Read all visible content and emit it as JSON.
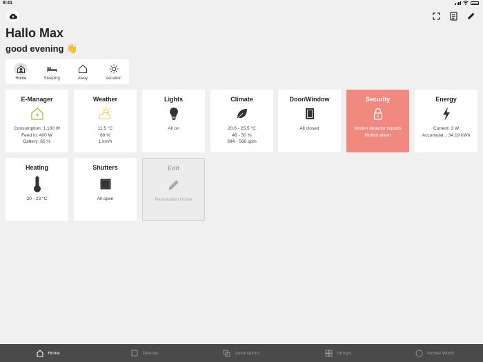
{
  "status_bar": {
    "time": "9:41"
  },
  "greeting": {
    "title": "Hallo Max",
    "subtitle": "good evening 👋"
  },
  "modes": [
    {
      "label": "Home",
      "icon": "home-person-icon",
      "active": true
    },
    {
      "label": "Sleeping",
      "icon": "bed-icon"
    },
    {
      "label": "Away",
      "icon": "house-outline-icon"
    },
    {
      "label": "Vacation",
      "icon": "sun-icon"
    }
  ],
  "tiles": {
    "emanager": {
      "title": "E-Manager",
      "lines": [
        "Consumption: 1,100 W",
        "Feed in: 400 W",
        "Battery: 85 %"
      ],
      "icon": "energy-house-icon",
      "color": "#9bbf3a"
    },
    "weather": {
      "title": "Weather",
      "lines": [
        "11.5 °C",
        "68 %",
        "1 km/h"
      ],
      "icon": "sun-cloud-icon",
      "color": "#f2c94c"
    },
    "lights": {
      "title": "Lights",
      "lines": [
        "All on"
      ],
      "icon": "lightbulb-icon"
    },
    "climate": {
      "title": "Climate",
      "lines": [
        "20.6 - 25.5 °C",
        "46 - 50 %",
        "384 - 566 ppm"
      ],
      "icon": "leaf-icon"
    },
    "doorwindow": {
      "title": "Door/Window",
      "lines": [
        "All closed"
      ],
      "icon": "window-icon"
    },
    "security": {
      "title": "Security",
      "lines": [
        "Motion detector reports",
        "Motion alarm"
      ],
      "icon": "lock-icon",
      "color": "#f08a80"
    },
    "energy": {
      "title": "Energy",
      "lines": [
        "Current: 3 W",
        "Accumulat... 34.19 kWh"
      ],
      "icon": "lightning-icon"
    },
    "heating": {
      "title": "Heating",
      "lines": [
        "20 - 23 °C"
      ],
      "icon": "thermometer-icon"
    },
    "shutters": {
      "title": "Shutters",
      "lines": [
        "All open"
      ],
      "icon": "shutter-icon"
    },
    "edit": {
      "title": "Edit",
      "lines": [
        "Personalize Home"
      ],
      "icon": "pencil-icon"
    }
  },
  "tabbar": [
    {
      "label": "Home",
      "icon": "home-icon",
      "active": true
    },
    {
      "label": "Devices",
      "icon": "devices-icon"
    },
    {
      "label": "Automations",
      "icon": "automations-icon"
    },
    {
      "label": "Groups",
      "icon": "groups-icon"
    },
    {
      "label": "homee World",
      "icon": "globe-icon"
    }
  ]
}
